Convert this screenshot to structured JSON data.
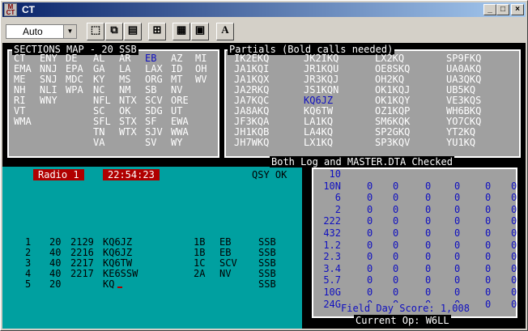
{
  "window": {
    "title": "CT"
  },
  "toolbar": {
    "mode_value": "Auto",
    "font_button": "A"
  },
  "sections": {
    "title": "SECTIONS MAP - 20 SSB",
    "columns": [
      [
        "CT",
        "EMA",
        "ME",
        "NH",
        "RI",
        "VT",
        "WMA"
      ],
      [
        "ENY",
        "NNJ",
        "SNJ",
        "NLI",
        "WNY"
      ],
      [
        "DE",
        "EPA",
        "MDC",
        "WPA"
      ],
      [
        "AL",
        "GA",
        "KY",
        "NC",
        "NFL",
        "SC",
        "SFL",
        "TN",
        "VA"
      ],
      [
        "AR",
        "LA",
        "MS",
        "NM",
        "NTX",
        "OK",
        "STX",
        "WTX"
      ],
      [
        "EB",
        "LAX",
        "ORG",
        "SB",
        "SCV",
        "SDG",
        "SF",
        "SJV",
        "SV"
      ],
      [
        "AZ",
        "ID",
        "MT",
        "NV",
        "ORE",
        "UT",
        "EWA",
        "WWA",
        "WY"
      ],
      [
        "MI",
        "OH",
        "WV"
      ]
    ],
    "highlight": "EB"
  },
  "partials": {
    "title": "Partials (Bold calls needed)",
    "columns": [
      [
        "IK2EKQ",
        "JA1KQI",
        "JA1KQX",
        "JA2RKQ",
        "JA7KQC",
        "JA8AKQ",
        "JF3KQA",
        "JH1KQB",
        "JH7WKQ"
      ],
      [
        "JK2IKQ",
        "JR1KQU",
        "JR3KQJ",
        "JS1KQN",
        "KQ6JZ",
        "KQ6TW",
        "LA1KQ",
        "LA4KQ",
        "LX1KQ"
      ],
      [
        "LX2KQ",
        "OE8SKQ",
        "OH2KQ",
        "OK1KQJ",
        "OK1KQY",
        "OZ1KQP",
        "SM6KQK",
        "SP2GKQ",
        "SP3KQV"
      ],
      [
        "SP9FKQ",
        "UA0AKQ",
        "UA3QKQ",
        "UB5KQ",
        "VE3KQS",
        "WH6BKQ",
        "YO7CKQ",
        "YT2KQ",
        "YU1KQ"
      ]
    ],
    "highlight": "KQ6JZ"
  },
  "banner": "Both Log and MASTER.DTA Checked",
  "log": {
    "radio": "Radio 1",
    "time": "22:54:23",
    "qsy": "QSY OK",
    "rows": [
      {
        "n": "1",
        "band": "20",
        "time": "2129",
        "call": "KQ6JZ",
        "cls": "1B",
        "sec": "EB",
        "mode": "SSB"
      },
      {
        "n": "2",
        "band": "40",
        "time": "2216",
        "call": "KQ6JZ",
        "cls": "1B",
        "sec": "EB",
        "mode": "SSB"
      },
      {
        "n": "3",
        "band": "40",
        "time": "2217",
        "call": "KQ6TW",
        "cls": "1C",
        "sec": "SCV",
        "mode": "SSB"
      },
      {
        "n": "4",
        "band": "40",
        "time": "2217",
        "call": "KE6SSW",
        "cls": "2A",
        "sec": "NV",
        "mode": "SSB"
      },
      {
        "n": "5",
        "band": "20",
        "time": "",
        "call": "KQ",
        "cls": "",
        "sec": "",
        "mode": "SSB"
      }
    ]
  },
  "bands": {
    "labels": [
      "10",
      "10N",
      "6",
      "2",
      "222",
      "432",
      "1.2",
      "2.3",
      "3.4",
      "5.7",
      "10G",
      "24G"
    ],
    "values": [
      "0",
      "0",
      "0",
      "0",
      "0",
      "0"
    ],
    "score": "Field Day Score: 1,008",
    "operator": "Current Op: W6LL"
  }
}
